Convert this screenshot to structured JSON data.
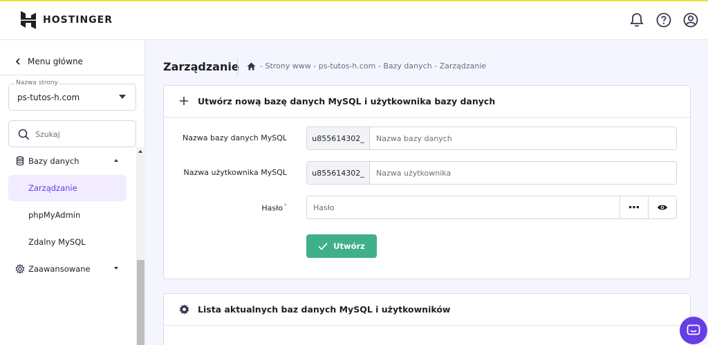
{
  "brand": {
    "name": "HOSTINGER",
    "logo_icon": "hostinger-logo-icon"
  },
  "topbar": {
    "icons": [
      "bell-icon",
      "help-icon",
      "user-icon"
    ]
  },
  "sidebar": {
    "back_label": "Menu główne",
    "site_select": {
      "label": "Nazwa strony",
      "value": "ps-tutos-h.com"
    },
    "search": {
      "placeholder": "Szukaj"
    },
    "items": [
      {
        "label": "Bazy danych",
        "icon": "database-icon",
        "expanded": true
      },
      {
        "label": "Zarządzanie",
        "active": true
      },
      {
        "label": "phpMyAdmin"
      },
      {
        "label": "Zdalny MySQL"
      },
      {
        "label": "Zaawansowane",
        "icon": "gear-icon",
        "expanded": false
      }
    ]
  },
  "page": {
    "title": "Zarządzanie",
    "breadcrumb": "- Strony www - ps-tutos-h.com - Bazy danych - Zarządzanie"
  },
  "create_card": {
    "title": "Utwórz nową bazę danych MySQL i użytkownika bazy danych",
    "db_name": {
      "label": "Nazwa bazy danych MySQL",
      "prefix": "u855614302_",
      "placeholder": "Nazwa bazy danych"
    },
    "db_user": {
      "label": "Nazwa użytkownika MySQL",
      "prefix": "u855614302_",
      "placeholder": "Nazwa użytkownika"
    },
    "password": {
      "label": "Hasło",
      "required_mark": "*",
      "placeholder": "Hasło"
    },
    "submit_label": "Utwórz"
  },
  "list_card": {
    "title": "Lista aktualnych baz danych MySQL i użytkowników"
  },
  "colors": {
    "accent": "#673de6",
    "success": "#3fb08b",
    "active_bg": "#f1ecff"
  }
}
